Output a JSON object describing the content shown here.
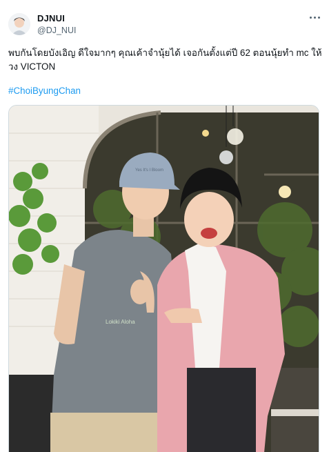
{
  "tweet": {
    "display_name": "DJNUI",
    "handle": "@DJ_NUI",
    "text": "พบกันโดยบังเอิญ ดีใจมากๆ คุณเค้าจำนุ้ยได้ เจอกันตั้งแต่ปี 62 ตอนนุ้ยทำ mc ให้วง VICTON",
    "hashtag": "#ChoiByungChan"
  },
  "photo": {
    "cap_text": "Yes It's I Bloom",
    "shirt_text": "Lokiki Aloha"
  },
  "colors": {
    "link": "#1d9bf0",
    "secondary_text": "#536471"
  },
  "icons": {
    "more": "more-horizontal-icon"
  }
}
